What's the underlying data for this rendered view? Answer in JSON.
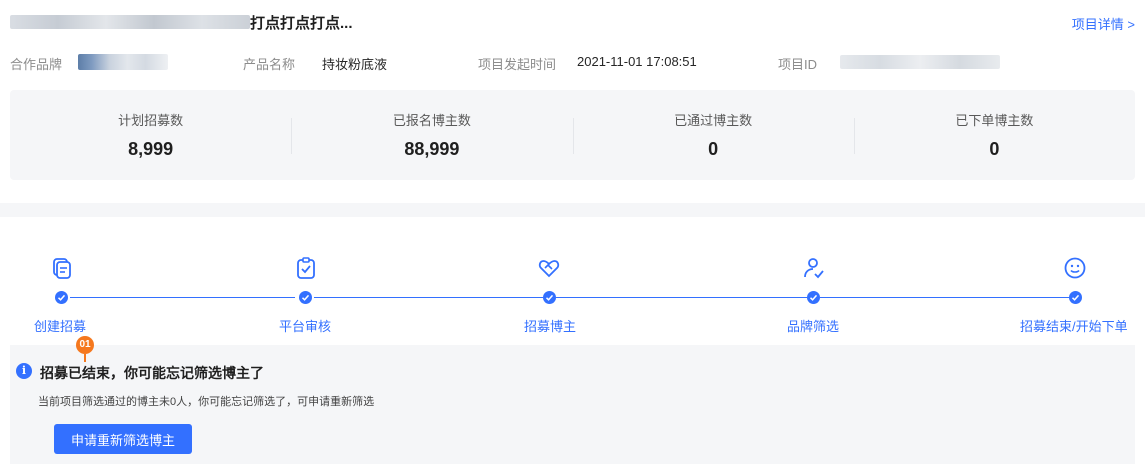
{
  "header": {
    "title_visible": "打点打点打点...",
    "detail_link": "项目详情 >"
  },
  "info": {
    "brand_label": "合作品牌",
    "product_label": "产品名称",
    "product_value": "持妆粉底液",
    "start_label": "项目发起时间",
    "start_value": "2021-11-01 17:08:51",
    "id_label": "项目ID"
  },
  "stats": [
    {
      "label": "计划招募数",
      "value": "8,999"
    },
    {
      "label": "已报名博主数",
      "value": "88,999"
    },
    {
      "label": "已通过博主数",
      "value": "0"
    },
    {
      "label": "已下单博主数",
      "value": "0"
    }
  ],
  "steps": [
    {
      "label": "创建招募",
      "icon": "copy-document-icon"
    },
    {
      "label": "平台审核",
      "icon": "clipboard-check-icon"
    },
    {
      "label": "招募博主",
      "icon": "handshake-icon"
    },
    {
      "label": "品牌筛选",
      "icon": "user-check-icon"
    },
    {
      "label": "招募结束/开始下单",
      "icon": "smile-icon"
    }
  ],
  "colors": {
    "primary": "#3370ff",
    "badge": "#f5781e",
    "panel": "#f5f6f8"
  },
  "notice": {
    "badge": "01",
    "title": "招募已结束，你可能忘记筛选博主了",
    "desc": "当前项目筛选通过的博主未0人，你可能忘记筛选了，可申请重新筛选",
    "button": "申请重新筛选博主"
  }
}
